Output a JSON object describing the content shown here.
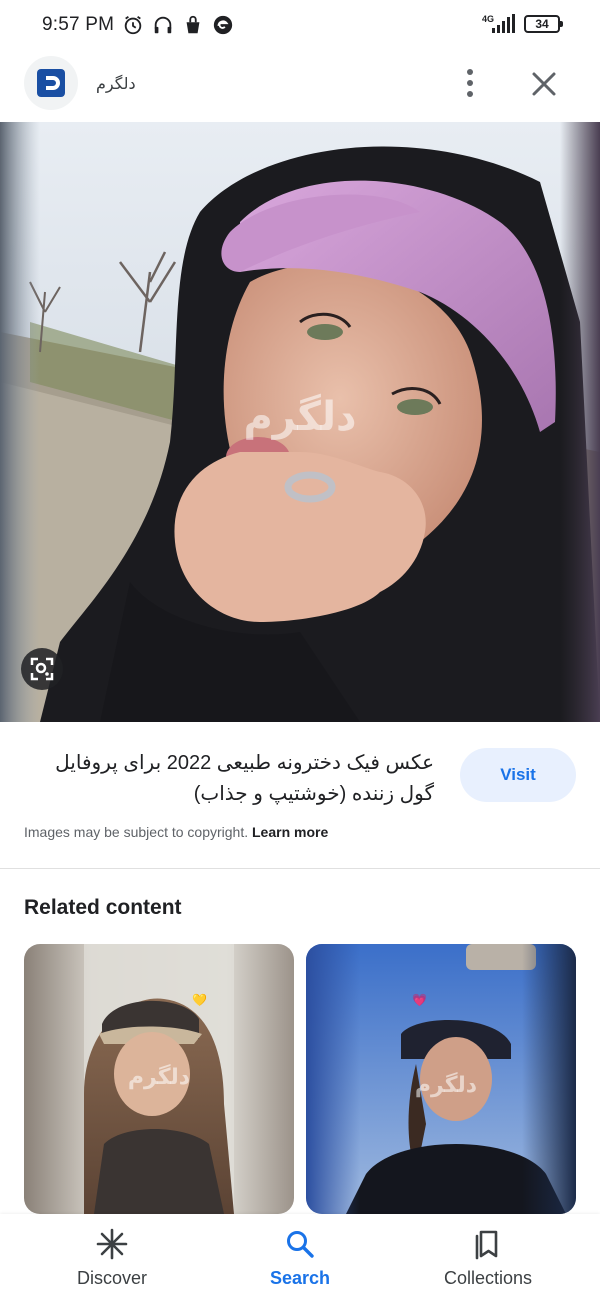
{
  "status_bar": {
    "time": "9:57 PM",
    "network": "4G",
    "battery": "34",
    "icons": [
      "alarm-icon",
      "headphones-icon",
      "shopping-bag-icon",
      "edge-icon",
      "signal-icon",
      "battery-icon"
    ]
  },
  "top_bar": {
    "site_name": "دلگرم",
    "icons": [
      "site-logo-icon",
      "more-vert-icon",
      "close-icon"
    ]
  },
  "image": {
    "watermark": "دلگرم",
    "lens_icon": "lens-icon"
  },
  "result": {
    "title": "عکس فیک دخترونه طبیعی 2022 برای پروفایل گول زننده (خوشتیپ و جذاب)",
    "visit_label": "Visit",
    "copyright_text": "Images may be subject to copyright.",
    "learn_more": "Learn more"
  },
  "related": {
    "title": "Related content",
    "cards": [
      {
        "watermark": "دلگرم",
        "emoji": "💛"
      },
      {
        "watermark": "دلگرم",
        "emoji": "💗"
      }
    ]
  },
  "bottom_nav": {
    "items": [
      {
        "label": "Discover",
        "icon": "discover-icon",
        "active": false
      },
      {
        "label": "Search",
        "icon": "search-icon",
        "active": true
      },
      {
        "label": "Collections",
        "icon": "collections-icon",
        "active": false
      }
    ]
  },
  "colors": {
    "accent": "#1a73e8",
    "visit_bg": "#e8f0fe",
    "text": "#202124",
    "muted": "#5f6368"
  }
}
